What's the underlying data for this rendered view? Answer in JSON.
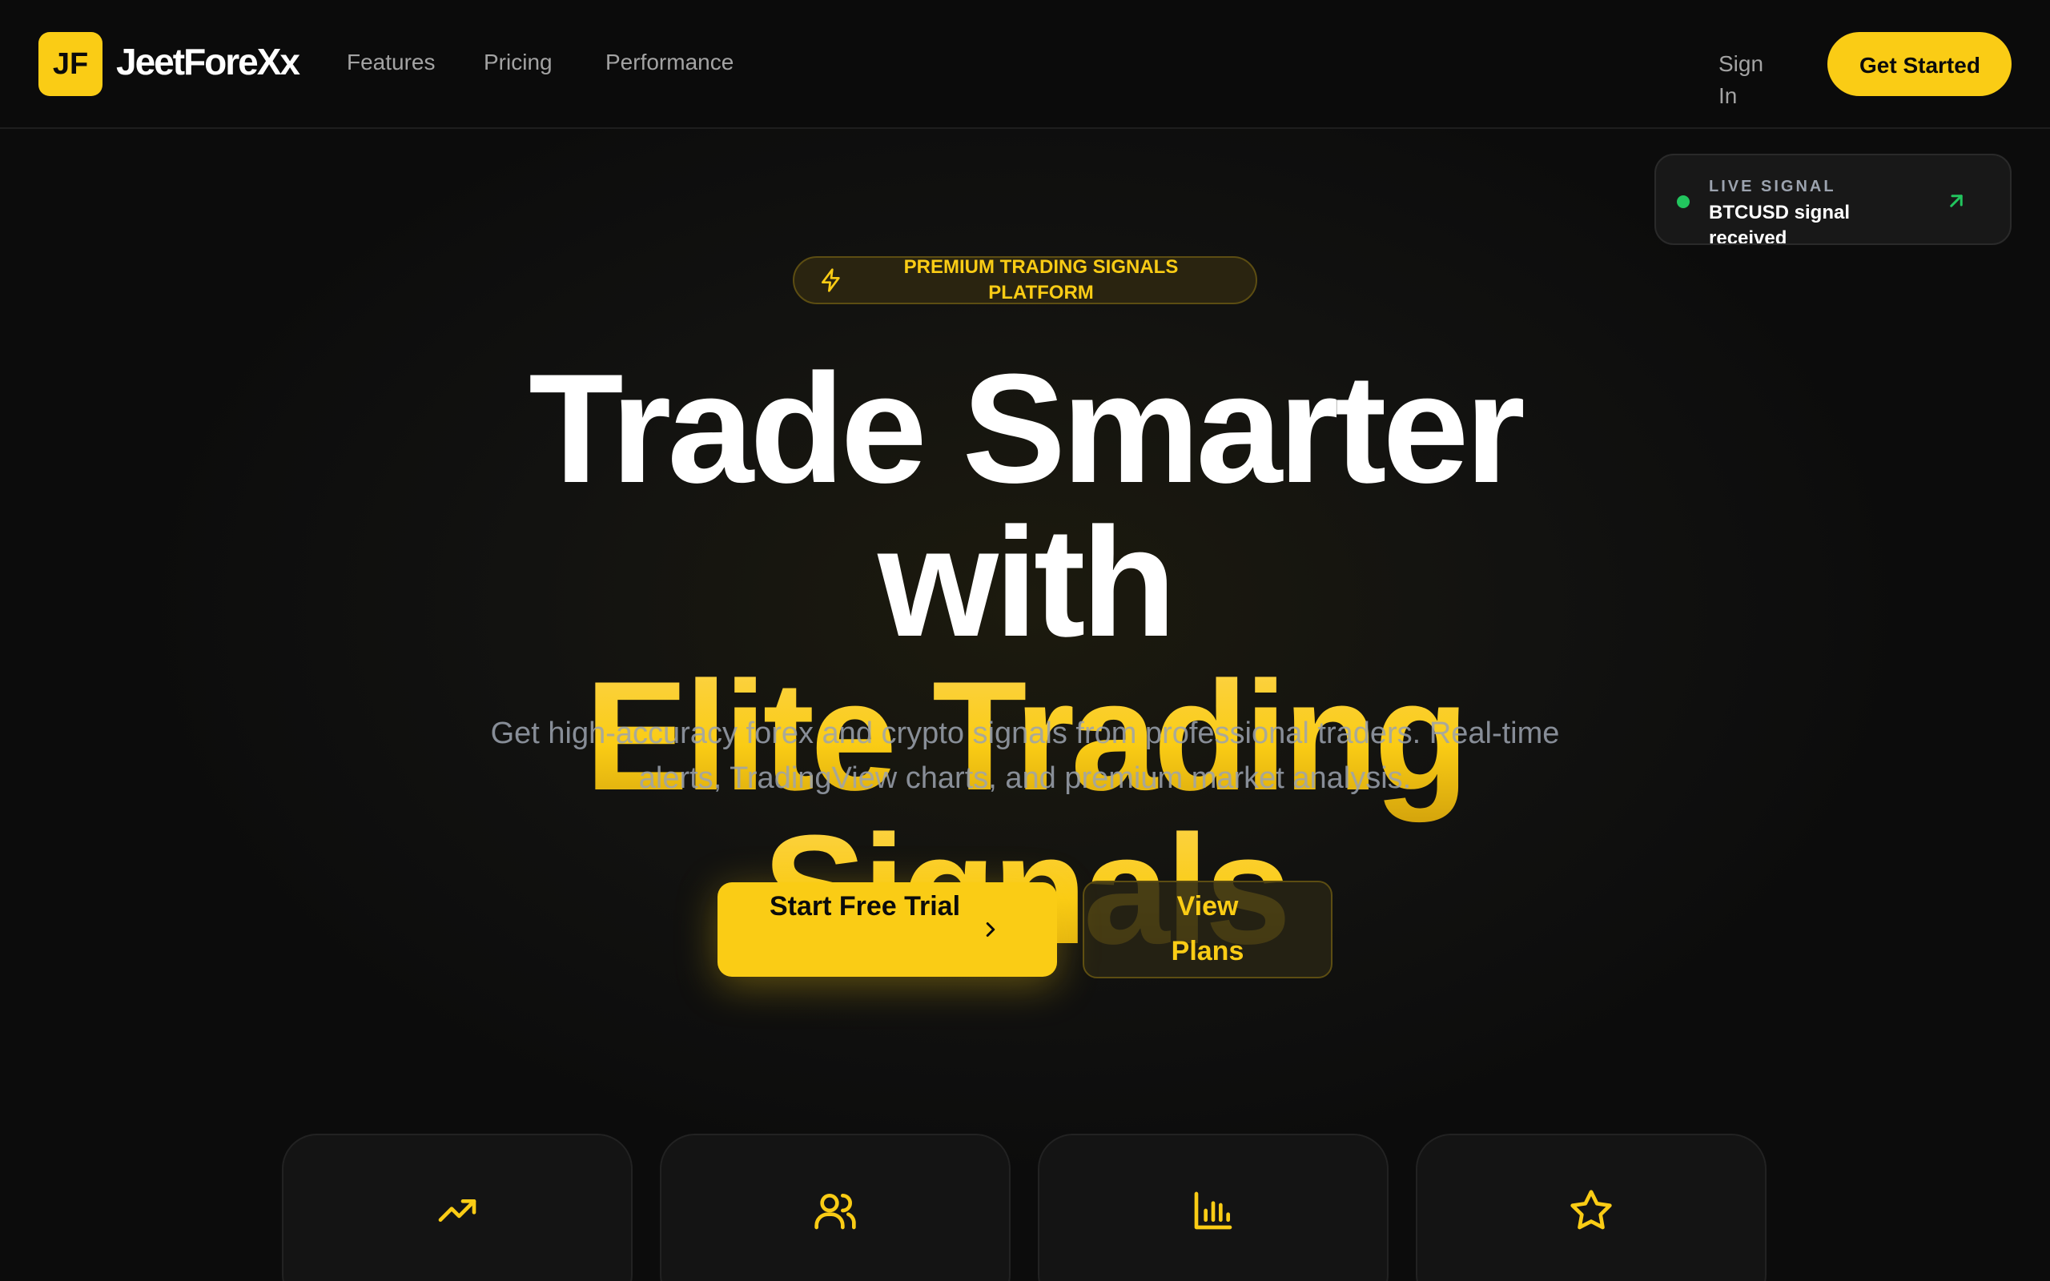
{
  "brand": {
    "logo_initials": "JF",
    "name": "JeetForeXx",
    "accent": "#facc15"
  },
  "nav": {
    "links": [
      "Features",
      "Pricing",
      "Performance"
    ],
    "signin": "Sign In",
    "get_started": "Get Started"
  },
  "live_signal": {
    "label": "LIVE SIGNAL",
    "message": "BTCUSD signal received",
    "status_color": "#22c55e",
    "icon": "arrow-up-right-icon"
  },
  "badge": {
    "text": "PREMIUM TRADING SIGNALS PLATFORM",
    "icon": "zap-icon"
  },
  "hero": {
    "title_line1": "Trade Smarter",
    "title_line2": "with",
    "title_highlight": "Elite Trading Signals",
    "subtitle": "Get high-accuracy forex and crypto signals from professional traders. Real-time alerts, TradingView charts, and premium market analysis."
  },
  "cta": {
    "primary": "Start Free Trial",
    "primary_icon": "chevron-right-icon",
    "secondary": "View Plans"
  },
  "features": {
    "icons": [
      "trending-up-icon",
      "users-icon",
      "bar-chart-icon",
      "star-icon"
    ]
  }
}
